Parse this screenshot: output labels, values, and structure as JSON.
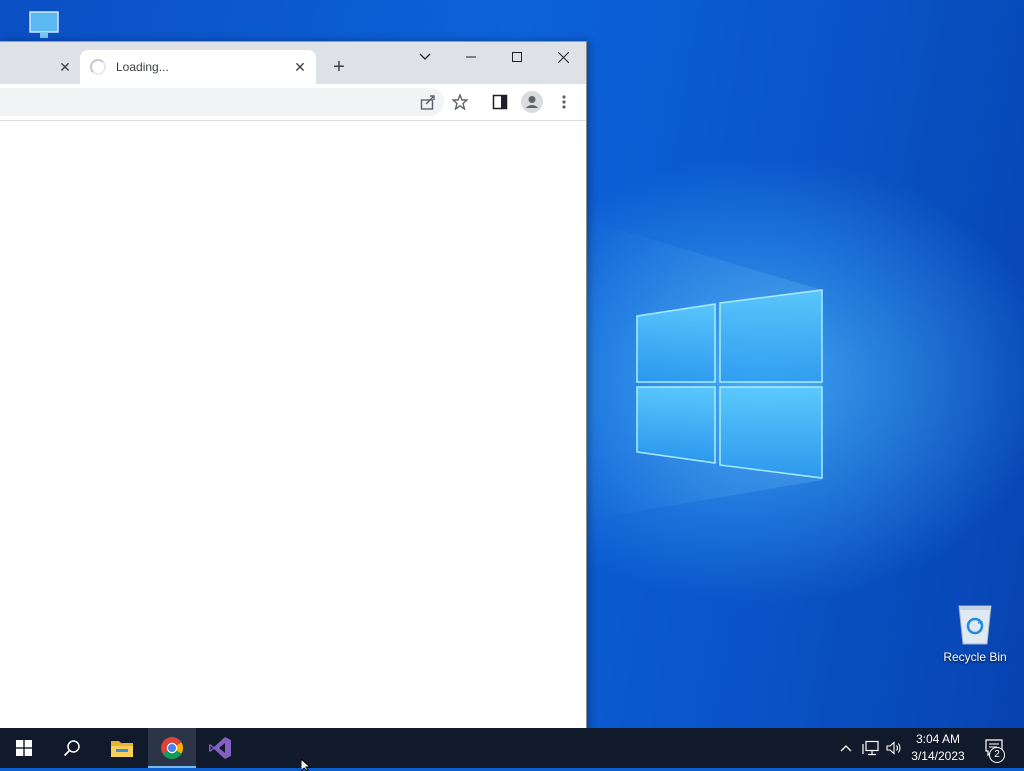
{
  "browser": {
    "tabs": [
      {
        "title": "",
        "close_label": "✕"
      },
      {
        "title": "Loading...",
        "close_label": "✕"
      }
    ],
    "new_tab_label": "+"
  },
  "desktop": {
    "recycle_bin_label": "Recycle Bin"
  },
  "taskbar": {
    "time": "3:04 AM",
    "date": "3/14/2023",
    "notification_count": "2"
  },
  "colors": {
    "tabstrip": "#dee1e6",
    "taskbar": "#101a2a",
    "accent": "#76b9ed"
  }
}
